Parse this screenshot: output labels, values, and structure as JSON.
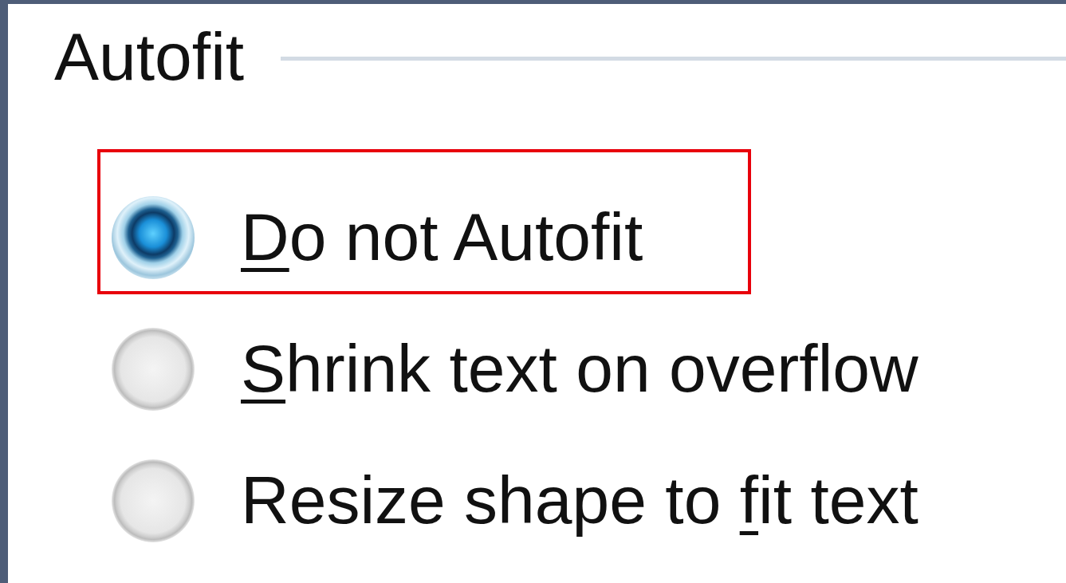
{
  "section": {
    "title": "Autofit"
  },
  "options": [
    {
      "access_key": "D",
      "label_after": "o not Autofit",
      "selected": true,
      "highlighted": true
    },
    {
      "access_key": "S",
      "label_after": "hrink text on overflow",
      "selected": false,
      "highlighted": false
    },
    {
      "label_before": "Resize shape to ",
      "access_key": "f",
      "label_after": "it text",
      "selected": false,
      "highlighted": false
    }
  ]
}
